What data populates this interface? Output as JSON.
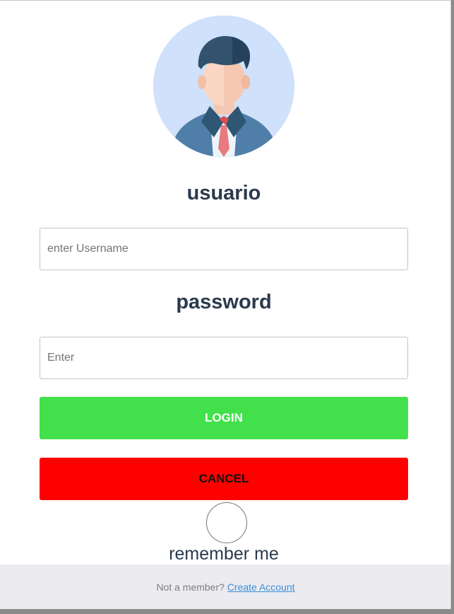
{
  "login_form": {
    "username_label": "usuario",
    "username_placeholder": "enter Username",
    "password_label": "password",
    "password_placeholder": "Enter",
    "login_button": "LOGIN",
    "cancel_button": "CANCEL",
    "remember_label": "remember me"
  },
  "footer": {
    "prompt": "Not a member?",
    "link": "Create Account"
  },
  "colors": {
    "login_button": "#42e14b",
    "cancel_button": "#ff0000",
    "heading_text": "#2a3a4d",
    "footer_background": "#ebebf0",
    "link": "#3b8fd6"
  },
  "avatar": {
    "icon": "user-businessman-icon"
  }
}
